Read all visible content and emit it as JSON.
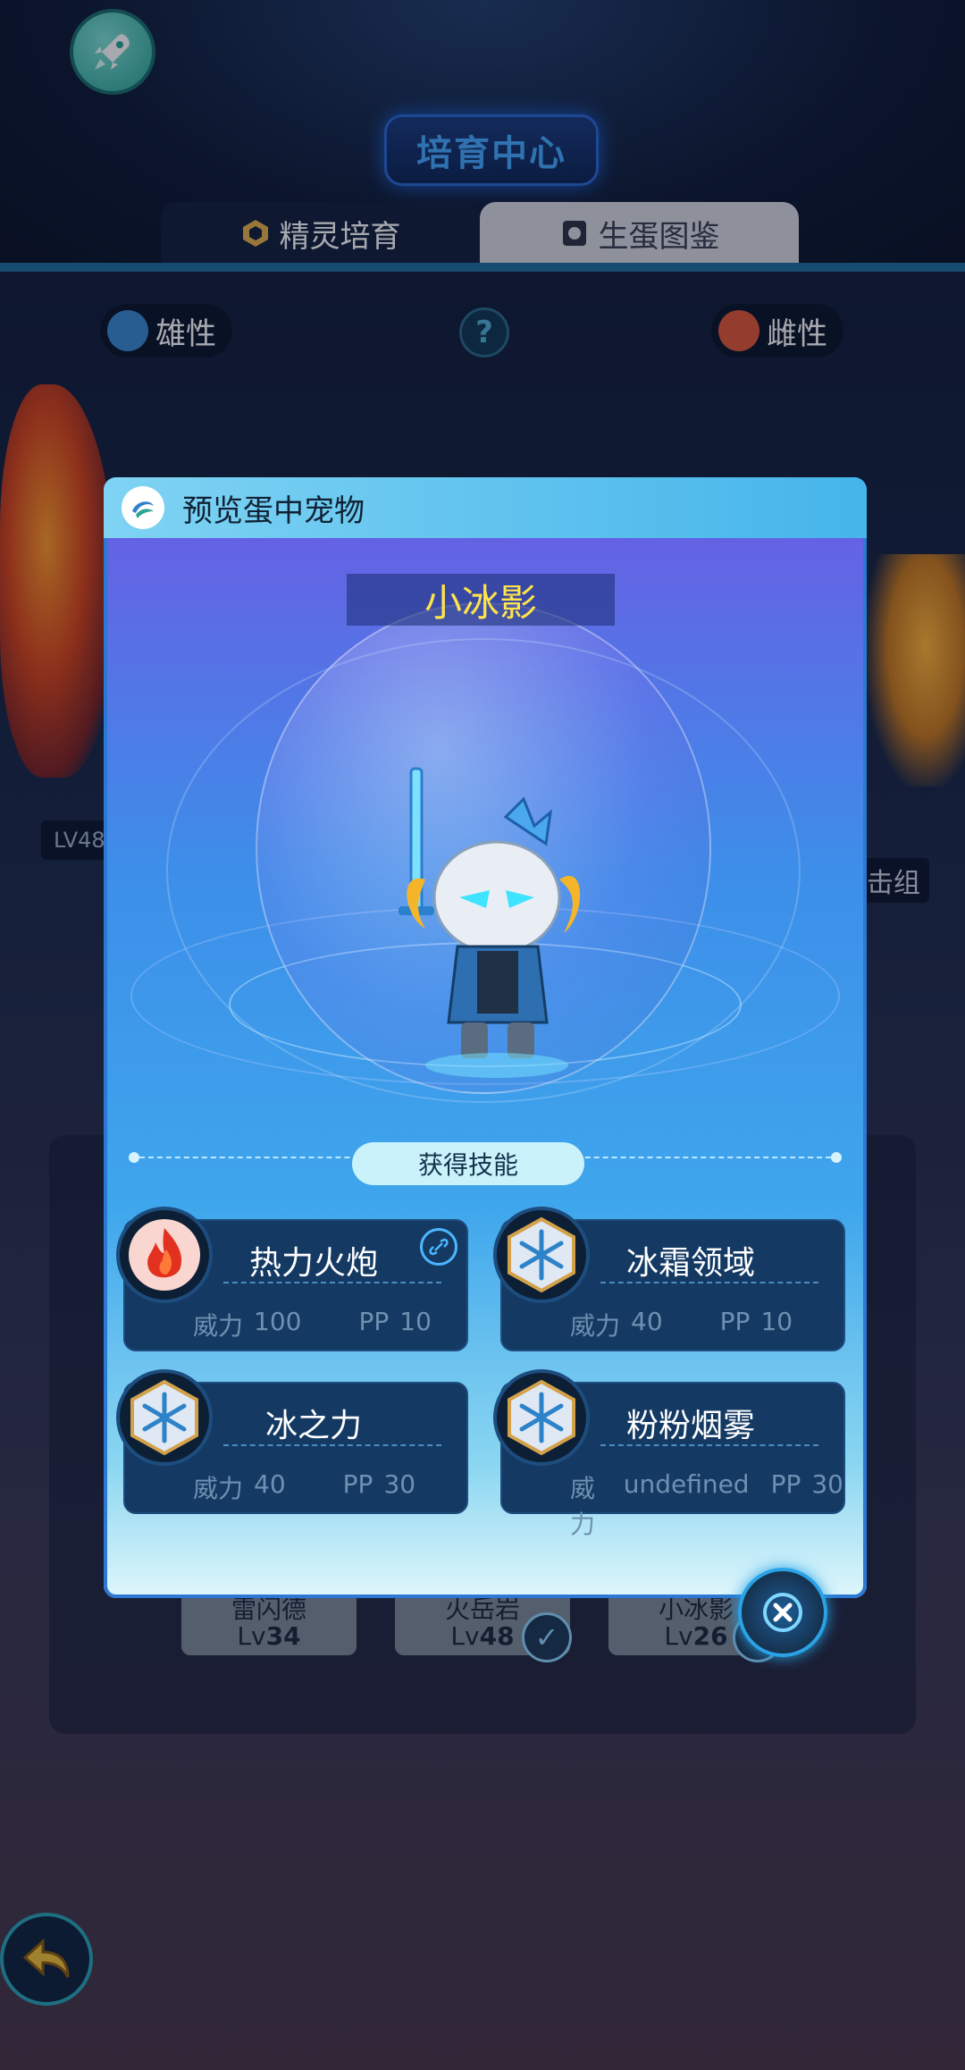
{
  "header": {
    "rocket_icon": "rocket-icon",
    "title": "培育中心",
    "tabs": [
      {
        "label": "精灵培育",
        "active": true,
        "icon": "hexagon-icon"
      },
      {
        "label": "生蛋图鉴",
        "active": false,
        "icon": "book-icon"
      }
    ]
  },
  "parents": {
    "male_label": "雄性",
    "female_label": "雌性",
    "help": "?"
  },
  "background_cards": [
    {
      "name": "雷闪德",
      "lv_prefix": "Lv",
      "lv": "34"
    },
    {
      "name": "火岳岩",
      "lv_prefix": "Lv",
      "lv": "48"
    },
    {
      "name": "小冰影",
      "lv_prefix": "Lv",
      "lv": "26"
    }
  ],
  "side_labels": {
    "left_lv": "LV48",
    "right_text": "击组"
  },
  "modal": {
    "title": "预览蛋中宠物",
    "pet_name": "小冰影",
    "skills_label": "获得技能",
    "power_label": "威力",
    "pp_label": "PP",
    "skills": [
      {
        "name": "热力火炮",
        "power": "100",
        "pp": "10",
        "icon": "fire-icon",
        "linked": true
      },
      {
        "name": "冰霜领域",
        "power": "40",
        "pp": "10",
        "icon": "snowflake-icon",
        "linked": false
      },
      {
        "name": "冰之力",
        "power": "40",
        "pp": "30",
        "icon": "snowflake-icon",
        "linked": false
      },
      {
        "name": "粉粉烟雾",
        "power": "undefined",
        "pp": "30",
        "icon": "snowflake-icon",
        "linked": false
      }
    ]
  },
  "colors": {
    "accent": "#3ea6ec",
    "name_yellow": "#ffe34a",
    "card_bg": "#143a64"
  }
}
